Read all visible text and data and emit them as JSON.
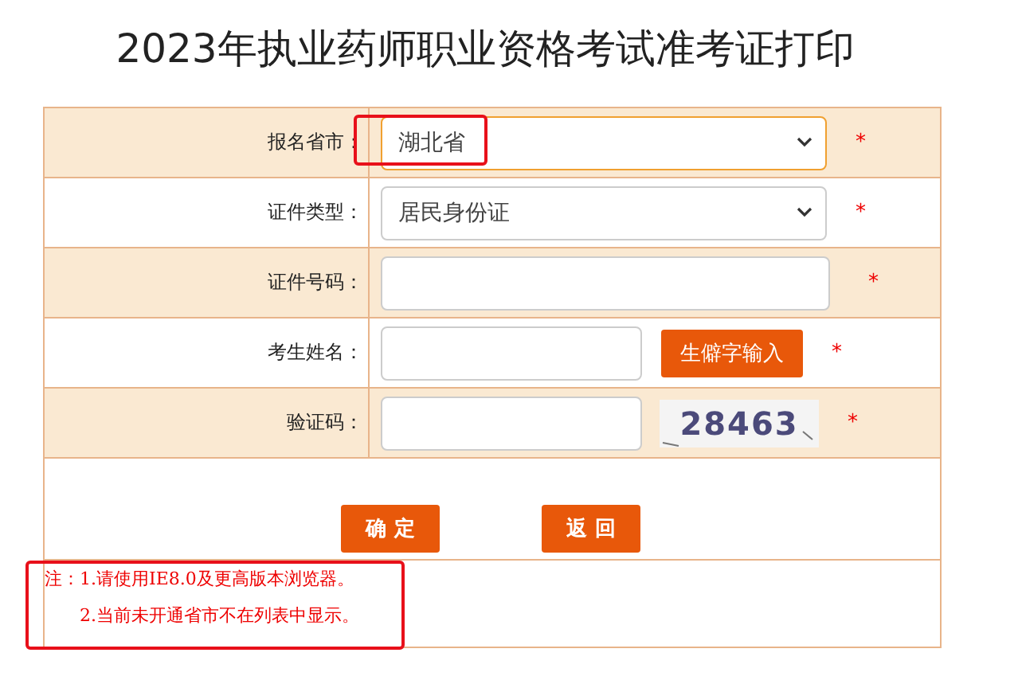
{
  "title": "2023年执业药师职业资格考试准考证打印",
  "fields": [
    {
      "kind": "select",
      "label": "报名省市：",
      "value": "湖北省",
      "required": "*",
      "highlighted": true
    },
    {
      "kind": "select",
      "label": "证件类型：",
      "value": "居民身份证",
      "required": "*",
      "highlighted": false
    },
    {
      "kind": "text",
      "label": "证件号码：",
      "required": "*",
      "highlighted": false
    },
    {
      "kind": "button",
      "label": "考生姓名：",
      "button": "生僻字输入",
      "required": "*",
      "highlighted": false
    },
    {
      "kind": "captcha",
      "label": "验证码：",
      "captcha": "28463",
      "required": "*",
      "highlighted": false
    }
  ],
  "buttons": [
    "确 定",
    "返 回"
  ],
  "notes": {
    "highlighted": true,
    "lines": [
      "注：1.请使用IE8.0及更高版本浏览器。",
      "2.当前未开通省市不在列表中显示。"
    ]
  }
}
